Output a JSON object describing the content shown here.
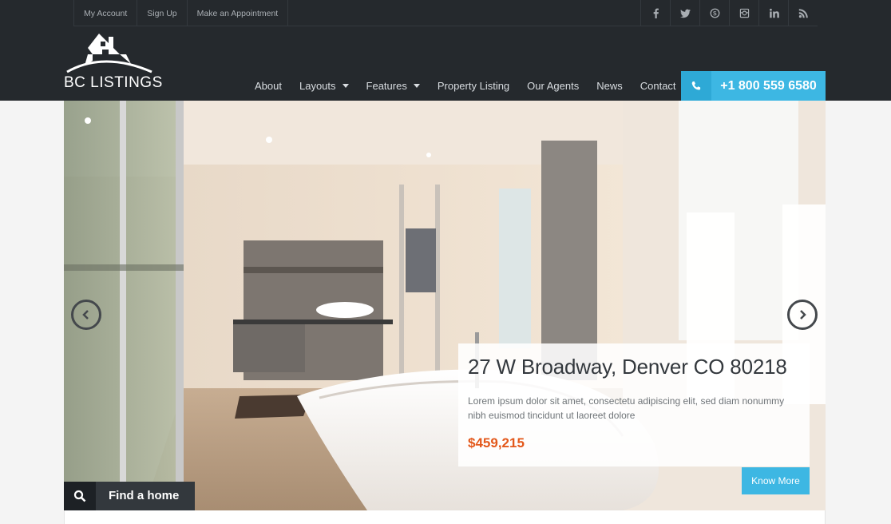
{
  "topbar": {
    "links": [
      "My Account",
      "Sign Up",
      "Make an Appointment"
    ],
    "social_icons": [
      "facebook-icon",
      "twitter-icon",
      "skype-icon",
      "instagram-icon",
      "linkedin-icon",
      "rss-icon"
    ]
  },
  "logo": {
    "text": "BC LISTINGS"
  },
  "nav": {
    "items": [
      {
        "label": "About"
      },
      {
        "label": "Layouts"
      },
      {
        "label": "Features"
      },
      {
        "label": "Property Listing"
      },
      {
        "label": "Our Agents"
      },
      {
        "label": "News"
      },
      {
        "label": "Contact"
      }
    ]
  },
  "phone": {
    "number": "+1 800 559 6580"
  },
  "hero": {
    "title": "27 W Broadway, Denver CO 80218",
    "description": "Lorem ipsum dolor sit amet, consectetu adipiscing elit, sed diam nonummy nibh euismod tincidunt ut laoreet dolore",
    "price": "$459,215",
    "cta_label": "Know More",
    "find_label": "Find a home"
  },
  "colors": {
    "header_bg": "#25292d",
    "accent": "#3db7e3",
    "price": "#e3581b",
    "page_bg": "#f4f4f4"
  }
}
